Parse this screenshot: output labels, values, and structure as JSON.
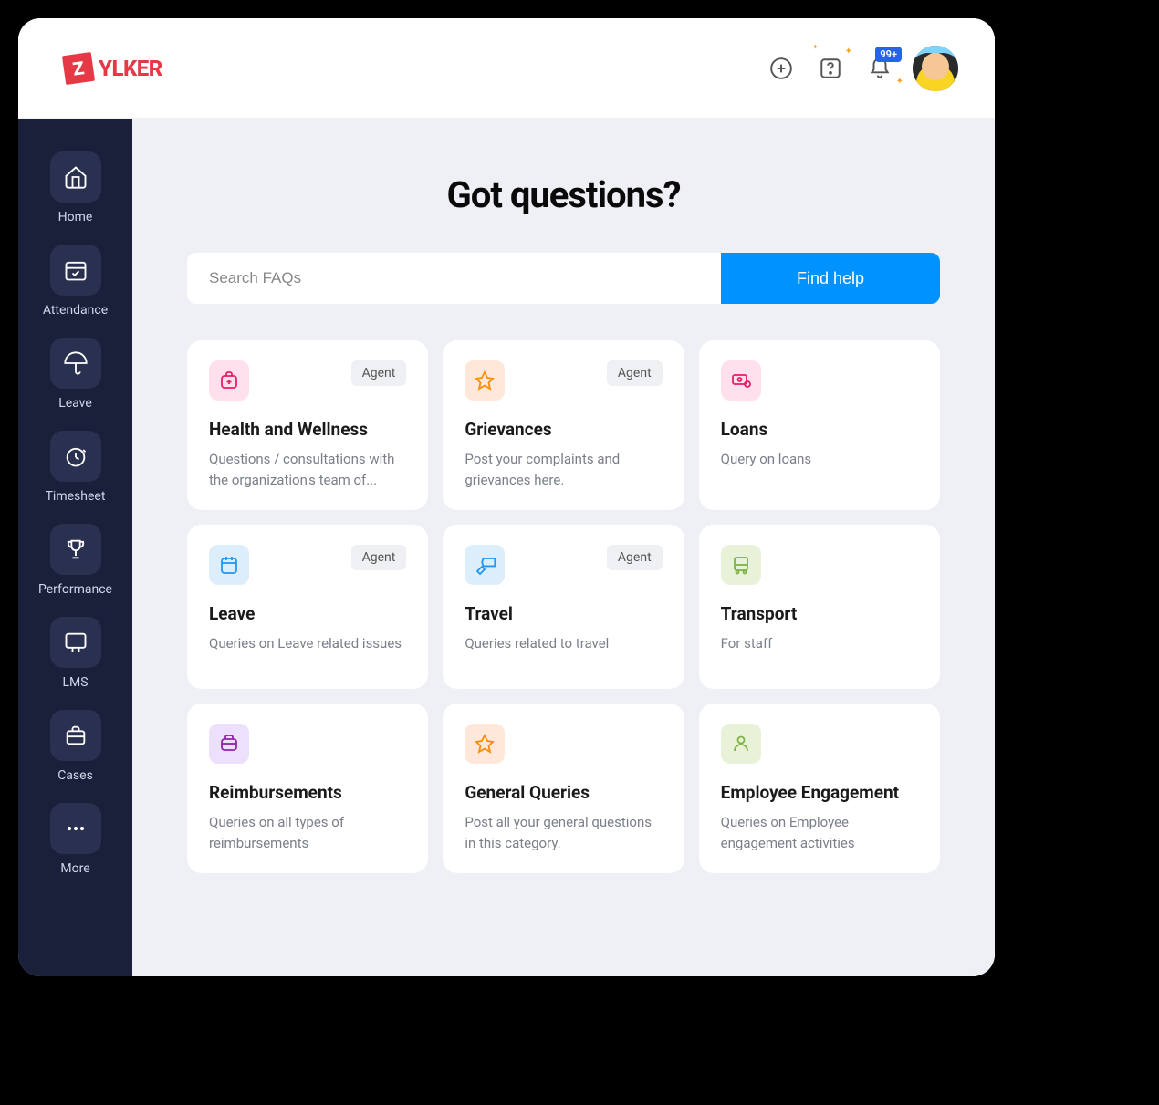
{
  "header": {
    "logo_text": "YLKER",
    "logo_mark": "Z",
    "notification_badge": "99+"
  },
  "sidebar": {
    "items": [
      {
        "label": "Home"
      },
      {
        "label": "Attendance"
      },
      {
        "label": "Leave"
      },
      {
        "label": "Timesheet"
      },
      {
        "label": "Performance"
      },
      {
        "label": "LMS"
      },
      {
        "label": "Cases"
      },
      {
        "label": "More"
      }
    ]
  },
  "main": {
    "title": "Got questions?",
    "search": {
      "placeholder": "Search FAQs",
      "button": "Find help"
    },
    "agent_label": "Agent",
    "cards": [
      {
        "title": "Health and Wellness",
        "desc": "Questions / consultations with the organization's team of...",
        "agent": true
      },
      {
        "title": "Grievances",
        "desc": "Post your complaints and grievances here.",
        "agent": true
      },
      {
        "title": "Loans",
        "desc": "Query on loans",
        "agent": false
      },
      {
        "title": "Leave",
        "desc": "Queries on Leave related issues",
        "agent": true
      },
      {
        "title": "Travel",
        "desc": "Queries related to travel",
        "agent": true
      },
      {
        "title": "Transport",
        "desc": "For staff",
        "agent": false
      },
      {
        "title": "Reimbursements",
        "desc": "Queries on all types of reimbursements",
        "agent": false
      },
      {
        "title": "General Queries",
        "desc": "Post all your general questions in this category.",
        "agent": false
      },
      {
        "title": "Employee Engagement",
        "desc": "Queries on Employee engagement activities",
        "agent": false
      }
    ]
  }
}
